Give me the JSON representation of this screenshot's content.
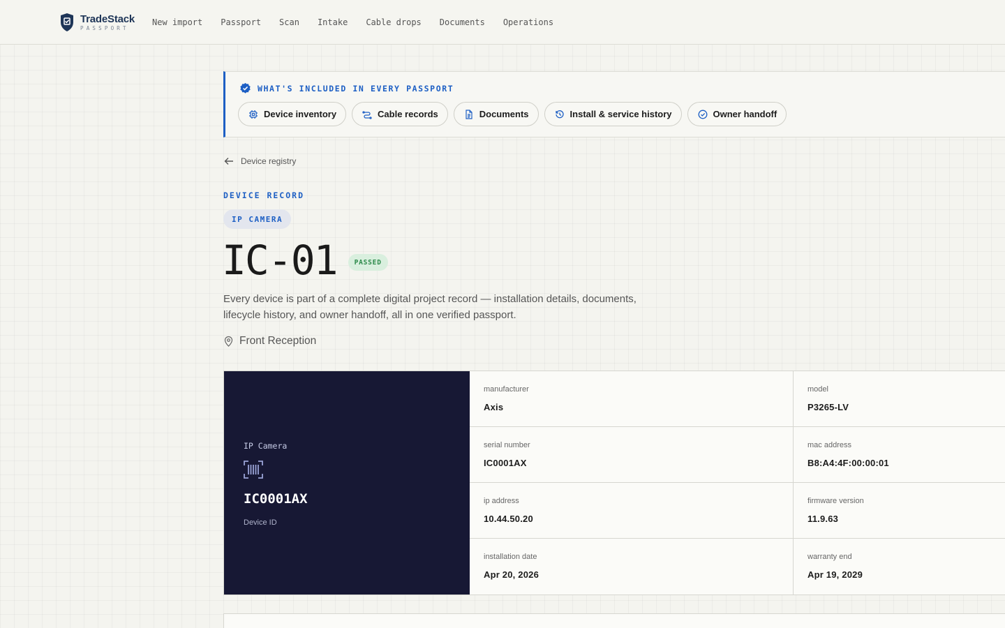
{
  "brand": {
    "name": "TradeStack",
    "sub": "PASSPORT"
  },
  "nav": [
    {
      "label": "New import"
    },
    {
      "label": "Passport"
    },
    {
      "label": "Scan"
    },
    {
      "label": "Intake"
    },
    {
      "label": "Cable drops"
    },
    {
      "label": "Documents"
    },
    {
      "label": "Operations"
    }
  ],
  "banner": {
    "title": "WHAT'S INCLUDED IN EVERY PASSPORT",
    "chips": [
      {
        "label": "Device inventory",
        "icon": "chip-icon"
      },
      {
        "label": "Cable records",
        "icon": "cable-icon"
      },
      {
        "label": "Documents",
        "icon": "document-icon"
      },
      {
        "label": "Install & service history",
        "icon": "history-icon"
      },
      {
        "label": "Owner handoff",
        "icon": "check-circle-icon"
      }
    ]
  },
  "breadcrumb": {
    "label": "Device registry"
  },
  "record": {
    "eyebrow": "DEVICE RECORD",
    "type_pill": "IP CAMERA",
    "title": "IC-01",
    "status": "PASSED",
    "description": "Every device is part of a complete digital project record — installation details, documents, lifecycle history, and owner handoff, all in one verified passport.",
    "location": "Front Reception"
  },
  "card": {
    "device_type": "IP Camera",
    "device_id": "IC0001AX",
    "device_id_label": "Device ID",
    "fields": [
      {
        "label": "manufacturer",
        "value": "Axis"
      },
      {
        "label": "model",
        "value": "P3265-LV"
      },
      {
        "label": "serial number",
        "value": "IC0001AX"
      },
      {
        "label": "mac address",
        "value": "B8:A4:4F:00:00:01"
      },
      {
        "label": "ip address",
        "value": "10.44.50.20"
      },
      {
        "label": "firmware version",
        "value": "11.9.63"
      },
      {
        "label": "installation date",
        "value": "Apr 20, 2026"
      },
      {
        "label": "warranty end",
        "value": "Apr 19, 2029"
      }
    ]
  },
  "colors": {
    "accent": "#1d5fc4",
    "brand": "#1e3557",
    "dark_panel": "#171834",
    "passed_bg": "#d9efde",
    "passed_text": "#2c8a4a",
    "background": "#f4f4ef"
  }
}
